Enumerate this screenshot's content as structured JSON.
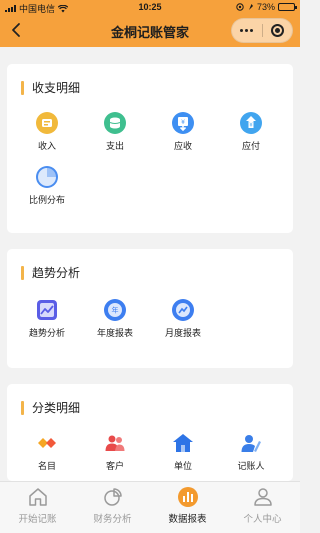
{
  "status_bar": {
    "carrier": "中国电信",
    "time": "10:25",
    "battery": "73%",
    "battery_level": 0.73
  },
  "nav": {
    "title": "金桐记账管家",
    "back_icon": "chevron-left-icon",
    "more_icon": "more-dots-icon",
    "close_icon": "target-close-icon"
  },
  "sections": [
    {
      "title": "收支明细",
      "items": [
        {
          "label": "收入",
          "icon": "income-icon",
          "color": "#f1b93b"
        },
        {
          "label": "支出",
          "icon": "expense-icon",
          "color": "#3fbf8f"
        },
        {
          "label": "应收",
          "icon": "receivable-icon",
          "color": "#3e8ff2"
        },
        {
          "label": "应付",
          "icon": "payable-icon",
          "color": "#41a5ef"
        },
        {
          "label": "比例分布",
          "icon": "pie-chart-icon",
          "color": "#4a8df0"
        }
      ]
    },
    {
      "title": "趋势分析",
      "items": [
        {
          "label": "趋势分析",
          "icon": "trend-icon",
          "color": "#5a5de6"
        },
        {
          "label": "年度报表",
          "icon": "annual-report-icon",
          "color": "#3d7ef0"
        },
        {
          "label": "月度报表",
          "icon": "monthly-report-icon",
          "color": "#3d7ef0"
        }
      ]
    },
    {
      "title": "分类明细",
      "items": [
        {
          "label": "名目",
          "icon": "category-icon",
          "color": "#f2593a"
        },
        {
          "label": "客户",
          "icon": "customer-icon",
          "color": "#e84a4a"
        },
        {
          "label": "单位",
          "icon": "company-icon",
          "color": "#2e74e6"
        },
        {
          "label": "记账人",
          "icon": "bookkeeper-icon",
          "color": "#3a7ee8"
        }
      ]
    }
  ],
  "tabbar": [
    {
      "label": "开始记账",
      "icon": "home-icon",
      "active": false
    },
    {
      "label": "财务分析",
      "icon": "analysis-pie-icon",
      "active": false
    },
    {
      "label": "数据报表",
      "icon": "report-bars-icon",
      "active": true
    },
    {
      "label": "个人中心",
      "icon": "user-icon",
      "active": false
    }
  ],
  "colors": {
    "nav_bg": "#f6a13c",
    "section_accent": "#f3b44a",
    "active_tab": "#f39a2e",
    "inactive_tab": "#9a9a9a"
  }
}
